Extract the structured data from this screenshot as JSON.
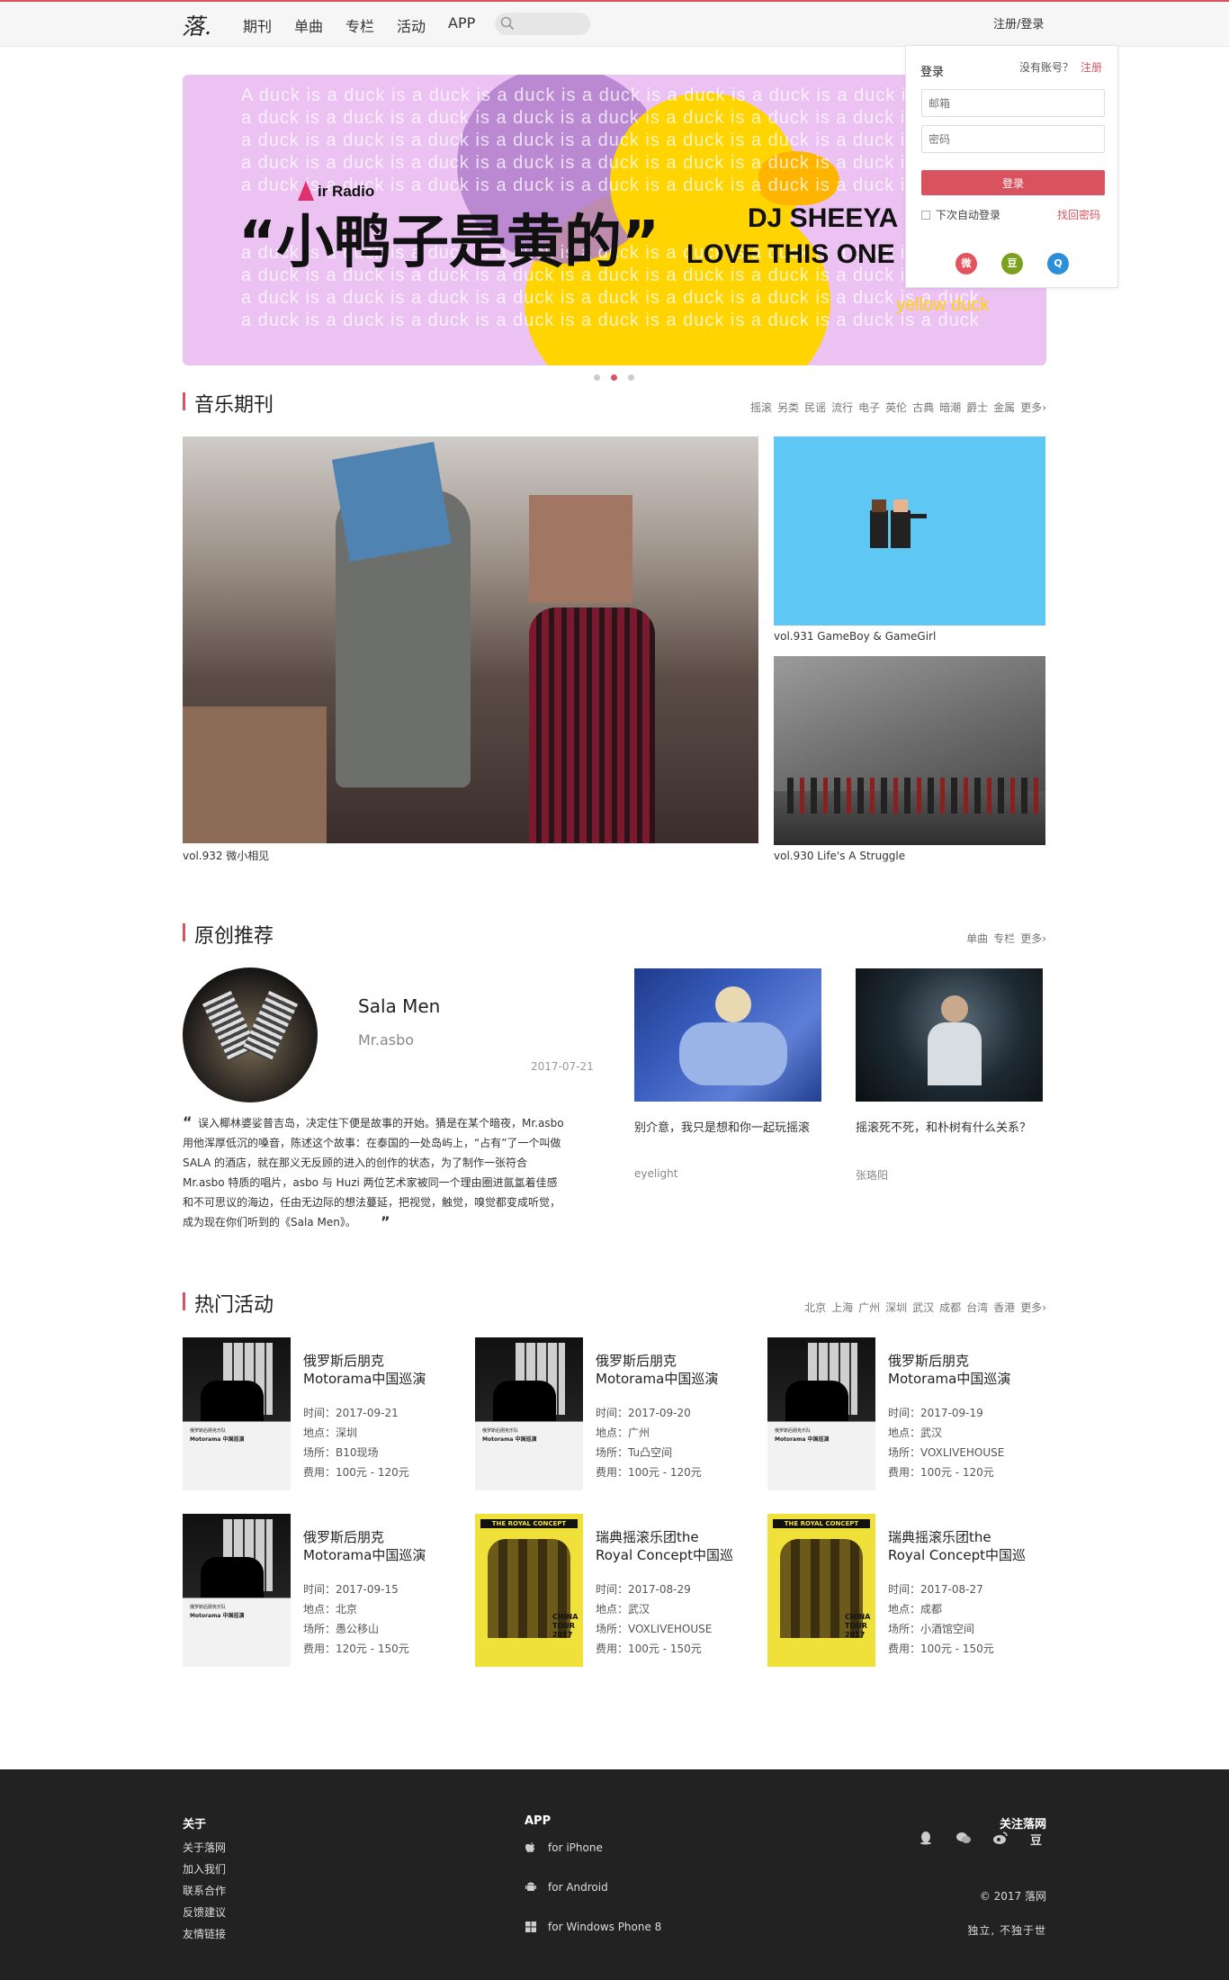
{
  "header": {
    "logo": "落.",
    "nav": [
      "期刊",
      "单曲",
      "专栏",
      "活动",
      "APP"
    ],
    "search_placeholder": "",
    "auth": "注册/登录"
  },
  "login": {
    "title": "登录",
    "no_account": "没有账号？",
    "register": "注册",
    "email_placeholder": "邮箱",
    "password_placeholder": "密码",
    "submit": "登录",
    "remember": "下次自动登录",
    "forgot": "找回密码"
  },
  "banner": {
    "pattern_line": "A duck is a duck is a duck is a duck is a duck is a duck is a duck is a duck is a duck",
    "pattern_line2": "a duck is a duck is a duck is a duck is a duck is a duck is a duck is a duck is a duck",
    "radio": "ir Radio",
    "title": "“小鸭子是黄的”",
    "dj": "DJ SHEEYA",
    "love": "LOVE THIS ONE",
    "yellow": "yellow duck",
    "active_slide": 2
  },
  "music": {
    "title": "音乐期刊",
    "tags": [
      "摇滚",
      "另类",
      "民谣",
      "流行",
      "电子",
      "英伦",
      "古典",
      "暗潮",
      "爵士",
      "金属",
      "更多"
    ],
    "items": [
      {
        "caption": "vol.932 微小相见"
      },
      {
        "caption": "vol.931 GameBoy & GameGirl"
      },
      {
        "caption": "vol.930 Life's A Struggle"
      }
    ]
  },
  "original": {
    "title": "原创推荐",
    "tags": [
      "单曲",
      "专栏",
      "更多"
    ],
    "featured": {
      "title": "Sala Men",
      "artist": "Mr.asbo",
      "date": "2017-07-21",
      "quote": [
        "误入椰林婆娑普吉岛，决定住下便是故事的开始。猜是在某个暗夜，Mr.asbo",
        "用他浑厚低沉的嗓音，陈述这个故事：在泰国的一处岛屿上，“占有”了一个叫做",
        "SALA 的酒店，就在那义无反顾的进入的创作的状态，为了制作一张符合",
        "Mr.asbo 特质的唱片，asbo 与 Huzi 两位艺术家被同一个理由圈进氤氲着佳感",
        "和不可思议的海边，任由无边际的想法蔓延，把视觉，触觉，嗅觉都变成听觉，",
        "成为现在你们听到的《Sala Men》。"
      ]
    },
    "cards": [
      {
        "title": "别介意，我只是想和你一起玩摇滚",
        "author": "eyelight"
      },
      {
        "title": "摇滚死不死，和朴树有什么关系？",
        "author": "张珞阳"
      }
    ]
  },
  "events": {
    "title": "热门活动",
    "tags": [
      "北京",
      "上海",
      "广州",
      "深圳",
      "武汉",
      "成都",
      "台湾",
      "香港",
      "更多"
    ],
    "items": [
      {
        "title1": "俄罗斯后朋克",
        "title2": "Motorama中国巡演",
        "time": "时间：2017-09-21",
        "place": "地点：深圳",
        "venue": "场所：B10现场",
        "fee": "费用：100元 - 120元",
        "poster": "motorama"
      },
      {
        "title1": "俄罗斯后朋克",
        "title2": "Motorama中国巡演",
        "time": "时间：2017-09-20",
        "place": "地点：广州",
        "venue": "场所：Tu凸空间",
        "fee": "费用：100元 - 120元",
        "poster": "motorama"
      },
      {
        "title1": "俄罗斯后朋克",
        "title2": "Motorama中国巡演",
        "time": "时间：2017-09-19",
        "place": "地点：武汉",
        "venue": "场所：VOXLIVEHOUSE",
        "fee": "费用：100元 - 120元",
        "poster": "motorama"
      },
      {
        "title1": "俄罗斯后朋克",
        "title2": "Motorama中国巡演",
        "time": "时间：2017-09-15",
        "place": "地点：北京",
        "venue": "场所：愚公移山",
        "fee": "费用：120元 - 150元",
        "poster": "motorama"
      },
      {
        "title1": "瑞典摇滚乐团the",
        "title2": "Royal Concept中国巡",
        "time": "时间：2017-08-29",
        "place": "地点：武汉",
        "venue": "场所：VOXLIVEHOUSE",
        "fee": "费用：100元 - 150元",
        "poster": "royal"
      },
      {
        "title1": "瑞典摇滚乐团the",
        "title2": "Royal Concept中国巡",
        "time": "时间：2017-08-27",
        "place": "地点：成都",
        "venue": "场所：小酒馆空间",
        "fee": "费用：100元 - 150元",
        "poster": "royal"
      }
    ],
    "poster_text": {
      "motorama_small": "俄罗斯后朋克乐队",
      "motorama_name": "Motorama 中国巡演",
      "royal_head": "THE ROYAL CONCEPT",
      "royal_tour1": "CHINA",
      "royal_tour2": "TOUR",
      "royal_year": "2017"
    }
  },
  "footer": {
    "about_title": "关于",
    "about_links": [
      "关于落网",
      "加入我们",
      "联系合作",
      "反馈建议",
      "友情链接"
    ],
    "app_title": "APP",
    "apps": [
      "for iPhone",
      "for Android",
      "for Windows Phone 8"
    ],
    "follow_title": "关注落网",
    "douban": "豆",
    "copyright": "© 2017 落网",
    "slogan": "独立, 不独于世"
  },
  "colors": {
    "accent": "#d9535f",
    "banner_bg": "#ecc2f3",
    "duck": "#ffd400",
    "footer_bg": "#222222"
  }
}
